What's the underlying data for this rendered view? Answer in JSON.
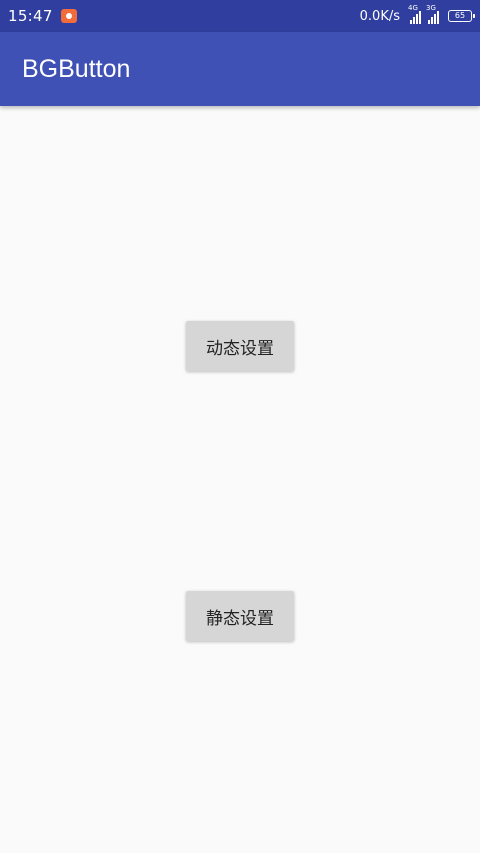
{
  "status_bar": {
    "time": "15:47",
    "net_speed": "0.0K/s",
    "sim1_type": "4G",
    "sim2_type": "3G",
    "battery_level": "65"
  },
  "app_bar": {
    "title": "BGButton"
  },
  "buttons": {
    "dynamic_label": "动态设置",
    "static_label": "静态设置"
  },
  "colors": {
    "status_bar": "#303f9f",
    "app_bar": "#3f51b5",
    "background": "#fafafa",
    "button": "#d6d6d6",
    "record_indicator": "#f26b3a"
  }
}
